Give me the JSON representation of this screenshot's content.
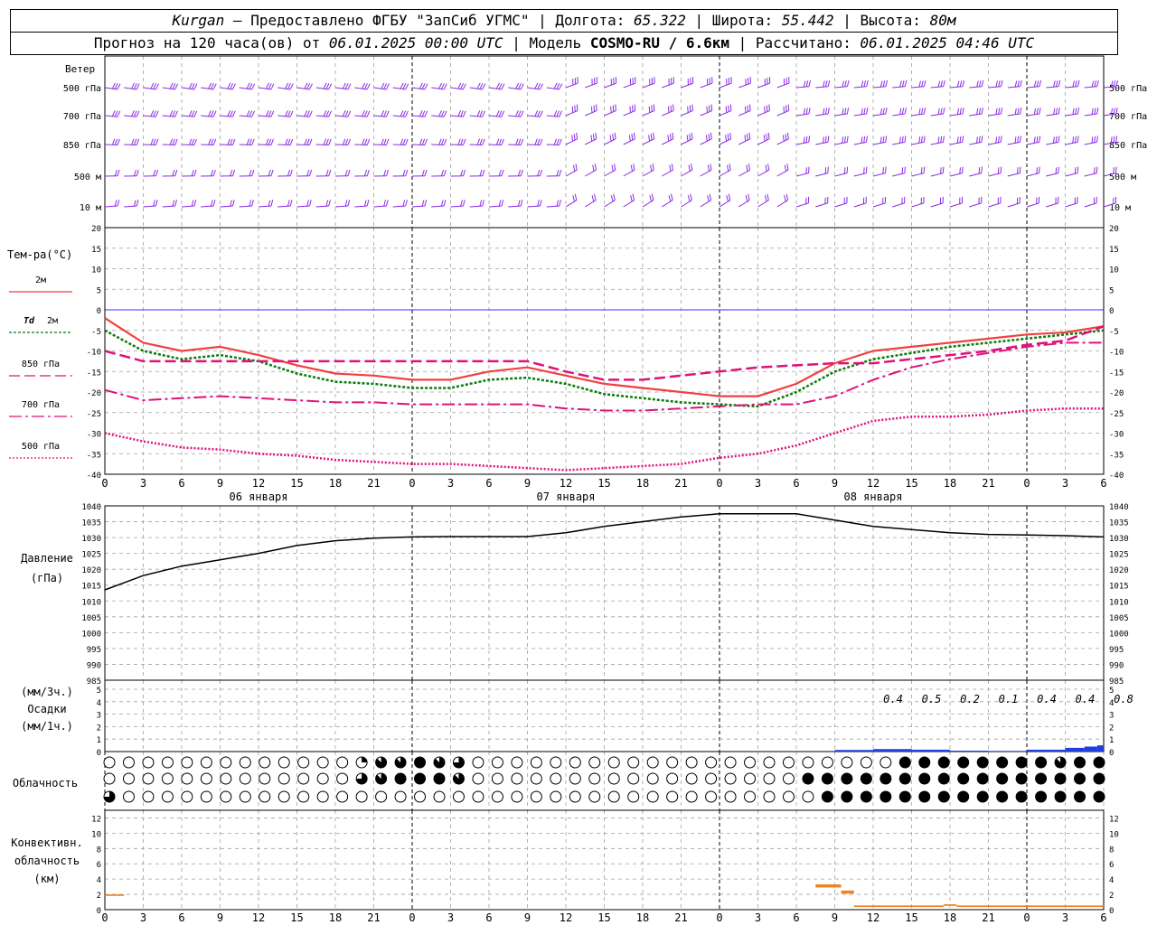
{
  "header": {
    "line1": {
      "station": "Kurgan",
      "sep": " – ",
      "provider": "Предоставлено ФГБУ \"ЗапСиб УГМС\"",
      "lon_label": " | Долгота: ",
      "lon": "65.322",
      "lat_label": " | Широта: ",
      "lat": "55.442",
      "alt_label": " | Высота: ",
      "alt": "80м"
    },
    "line2": {
      "forecast_label": "Прогноз на 120 часа(ов) от ",
      "forecast_from": "06.01.2025 00:00 UTC",
      "model_label": "  | Модель ",
      "model": "COSMO-RU / 6.6км",
      "computed_label": " | Рассчитано: ",
      "computed": "06.01.2025 04:46 UTC"
    }
  },
  "colors": {
    "wind": "#8a2be2",
    "t2m": "#f04040",
    "td2m": "#0a7a0a",
    "t850": "#e0107a",
    "t700": "#e0107a",
    "t500": "#e0107a",
    "zero_line": "#3030ff",
    "pressure": "#000000",
    "precip": "#2040e0",
    "convective": "#f08020",
    "grid": "#a0a0a0"
  },
  "chart_data": [
    {
      "type": "wind_barbs",
      "title": "Ветер",
      "levels": [
        "500 гПа",
        "700 гПа",
        "850 гПа",
        "500 м",
        "10 м"
      ]
    },
    {
      "type": "line",
      "ylabel": "Тем-ра(°С)",
      "ylim": [
        -40,
        20
      ],
      "yticks": [
        20,
        15,
        10,
        5,
        0,
        -5,
        -10,
        -15,
        -20,
        -25,
        -30,
        -35,
        -40
      ],
      "x_hours": [
        0,
        3,
        6,
        9,
        12,
        15,
        18,
        21,
        24,
        27,
        30,
        33,
        36,
        39,
        42,
        45,
        48,
        51,
        54,
        57,
        60,
        63,
        66,
        69,
        72,
        75,
        78
      ],
      "x_ticklabels": [
        "0",
        "3",
        "6",
        "9",
        "12",
        "15",
        "18",
        "21",
        "0",
        "3",
        "6",
        "9",
        "12",
        "15",
        "18",
        "21",
        "0",
        "3",
        "6",
        "9",
        "12",
        "15",
        "18",
        "21",
        "0",
        "3",
        "6"
      ],
      "date_labels": [
        {
          "hour": 12,
          "text": "06 января"
        },
        {
          "hour": 36,
          "text": "07 января"
        },
        {
          "hour": 60,
          "text": "08 января"
        }
      ],
      "series": [
        {
          "name": "2м",
          "style": "t2m",
          "values": [
            -2,
            -8,
            -10,
            -9,
            -11,
            -13.5,
            -15.5,
            -16,
            -17,
            -17,
            -15,
            -14,
            -16,
            -18,
            -19,
            -20,
            -21,
            -21,
            -18,
            -13,
            -10,
            -9,
            -8,
            -7,
            -6,
            -5.5,
            -4
          ]
        },
        {
          "name": "Td 2м",
          "style": "td2m",
          "values": [
            -5,
            -10,
            -12,
            -11,
            -12.5,
            -15.5,
            -17.5,
            -18,
            -19,
            -19,
            -17,
            -16.5,
            -18,
            -20.5,
            -21.5,
            -22.5,
            -23,
            -23.5,
            -20,
            -15,
            -12,
            -10.5,
            -9,
            -8,
            -7,
            -6,
            -5
          ]
        },
        {
          "name": "850 гПа",
          "style": "t850",
          "values": [
            -10,
            -12.5,
            -12.5,
            -12.5,
            -12.5,
            -12.5,
            -12.5,
            -12.5,
            -12.5,
            -12.5,
            -12.5,
            -12.5,
            -15,
            -17,
            -17,
            -16,
            -15,
            -14,
            -13.5,
            -13,
            -13,
            -12,
            -11,
            -10,
            -8.5,
            -7.5,
            -4
          ]
        },
        {
          "name": "700 гПа",
          "style": "t700",
          "values": [
            -19.5,
            -22,
            -21.5,
            -21,
            -21.5,
            -22,
            -22.5,
            -22.5,
            -23,
            -23,
            -23,
            -23,
            -24,
            -24.5,
            -24.5,
            -24,
            -23.5,
            -23,
            -23,
            -21,
            -17,
            -14,
            -12,
            -10.5,
            -9,
            -8,
            -8
          ]
        },
        {
          "name": "500 гПа",
          "style": "t500",
          "values": [
            -30,
            -32,
            -33.5,
            -34,
            -35,
            -35.5,
            -36.5,
            -37,
            -37.5,
            -37.5,
            -38,
            -38.5,
            -39,
            -38.5,
            -38,
            -37.5,
            -36,
            -35,
            -33,
            -30,
            -27,
            -26,
            -26,
            -25.5,
            -24.5,
            -24,
            -24
          ]
        }
      ],
      "zero_line": 0
    },
    {
      "type": "line",
      "ylabel": "Давление",
      "yunit": "(гПа)",
      "ylim": [
        985,
        1040
      ],
      "yticks": [
        1040,
        1035,
        1030,
        1025,
        1020,
        1015,
        1010,
        1005,
        1000,
        995,
        990,
        985
      ],
      "series": [
        {
          "name": "Давление",
          "values": [
            1013.5,
            1018,
            1021,
            1023,
            1025,
            1027.5,
            1029,
            1029.8,
            1030.2,
            1030.3,
            1030.3,
            1030.3,
            1031.5,
            1033.5,
            1035,
            1036.5,
            1037.5,
            1037.5,
            1037.5,
            1035.5,
            1033.5,
            1032.5,
            1031.5,
            1031,
            1030.8,
            1030.6,
            1030.2
          ]
        }
      ]
    },
    {
      "type": "bar",
      "ylabel": "Осадки",
      "yunit_top": "(мм/3ч.)",
      "yunit_bottom": "(мм/1ч.)",
      "ylim": [
        0,
        5
      ],
      "yticks": [
        5,
        4,
        3,
        2,
        1,
        0
      ],
      "labels_3h": [
        {
          "hour": 60,
          "text": "0.4"
        },
        {
          "hour": 63,
          "text": "0.5"
        },
        {
          "hour": 66,
          "text": "0.2"
        },
        {
          "hour": 69,
          "text": "0.1"
        },
        {
          "hour": 72,
          "text": "0.4"
        },
        {
          "hour": 75,
          "text": "0.4"
        },
        {
          "hour": 78,
          "text": "0.8"
        }
      ],
      "bars_1h": [
        {
          "from": 57,
          "to": 60,
          "value": 0.13
        },
        {
          "from": 60,
          "to": 63,
          "value": 0.2
        },
        {
          "from": 63,
          "to": 66,
          "value": 0.15
        },
        {
          "from": 66,
          "to": 69,
          "value": 0.07
        },
        {
          "from": 69,
          "to": 72,
          "value": 0.05
        },
        {
          "from": 72,
          "to": 75,
          "value": 0.15
        },
        {
          "from": 75,
          "to": 76.5,
          "value": 0.3
        },
        {
          "from": 76.5,
          "to": 77.5,
          "value": 0.4
        },
        {
          "from": 77.5,
          "to": 78,
          "value": 0.5
        }
      ]
    },
    {
      "type": "cloud_symbols",
      "ylabel": "Облачность",
      "rows": [
        {
          "name": "upper",
          "values": [
            0,
            0,
            0,
            0,
            0,
            0,
            0,
            0,
            0,
            0,
            0,
            0,
            0,
            0,
            0,
            0,
            0,
            0,
            0,
            0,
            0,
            0,
            0,
            0,
            0,
            0,
            0,
            0,
            0,
            0,
            0,
            0,
            0,
            0,
            0,
            0,
            0,
            0,
            0,
            0,
            1,
            2,
            3,
            5,
            7,
            6,
            8,
            7,
            8,
            7,
            8,
            7,
            8,
            7,
            7,
            6,
            5,
            6,
            4,
            2,
            0,
            0,
            0,
            0,
            0,
            0,
            0,
            0,
            0,
            0,
            0,
            0,
            0,
            0,
            0,
            0,
            0,
            0,
            0,
            0,
            0,
            0,
            0,
            0,
            0,
            0,
            0,
            0,
            0,
            0,
            0,
            0,
            0,
            0,
            0,
            0,
            0,
            0,
            0,
            0,
            0,
            0,
            0,
            0,
            0,
            0,
            0,
            0,
            0,
            0,
            0,
            0,
            0,
            0,
            0,
            0,
            0,
            0,
            0,
            0,
            0,
            0,
            0,
            0,
            0,
            0,
            0,
            0,
            8,
            8,
            8,
            8,
            8,
            8,
            8,
            8,
            8,
            8,
            8,
            8,
            8,
            7,
            8,
            8,
            8,
            8,
            7,
            8,
            8,
            8,
            8,
            7,
            8,
            8,
            8,
            7,
            8,
            8,
            8,
            8,
            8,
            8,
            8,
            8,
            4
          ]
        },
        {
          "name": "middle",
          "values": [
            0,
            0,
            0,
            0,
            0,
            0,
            0,
            0,
            0,
            0,
            0,
            0,
            0,
            0,
            0,
            0,
            0,
            0,
            0,
            0,
            0,
            0,
            0,
            0,
            0,
            0,
            0,
            0,
            0,
            0,
            0,
            0,
            0,
            0,
            0,
            0,
            0,
            0,
            0,
            0,
            2,
            4,
            3,
            6,
            7,
            8,
            7,
            8,
            8,
            8,
            8,
            8,
            8,
            8,
            8,
            8,
            8,
            8,
            8,
            7,
            0,
            0,
            0,
            0,
            0,
            0,
            0,
            0,
            0,
            0,
            0,
            0,
            0,
            0,
            0,
            0,
            0,
            0,
            0,
            0,
            0,
            0,
            0,
            0,
            0,
            0,
            0,
            0,
            0,
            0,
            0,
            0,
            0,
            0,
            0,
            0,
            0,
            0,
            0,
            0,
            0,
            0,
            0,
            0,
            0,
            0,
            0,
            0,
            0,
            0,
            0,
            0,
            0,
            0,
            0,
            0,
            0,
            4,
            8,
            8,
            8,
            8,
            8,
            8,
            8,
            8,
            8,
            8,
            8,
            8,
            8,
            8,
            8,
            8,
            8,
            8,
            8,
            8,
            8,
            8,
            8,
            8,
            8,
            8,
            8,
            8,
            8,
            8,
            8,
            8,
            8,
            8,
            8,
            8,
            8,
            8,
            8,
            8,
            8,
            8,
            8,
            8,
            8,
            8,
            8,
            8,
            8,
            8,
            8,
            8,
            8,
            8
          ]
        },
        {
          "name": "lower",
          "values": [
            6,
            0,
            0,
            0,
            0,
            0,
            0,
            0,
            0,
            0,
            0,
            0,
            0,
            0,
            0,
            0,
            0,
            0,
            0,
            0,
            0,
            0,
            0,
            0,
            0,
            0,
            0,
            0,
            0,
            0,
            0,
            0,
            0,
            0,
            0,
            0,
            0,
            0,
            0,
            0,
            0,
            0,
            0,
            0,
            0,
            0,
            0,
            0,
            0,
            0,
            0,
            0,
            0,
            0,
            0,
            0,
            0,
            0,
            0,
            0,
            0,
            0,
            0,
            0,
            0,
            0,
            0,
            0,
            0,
            0,
            0,
            0,
            0,
            0,
            0,
            0,
            0,
            0,
            0,
            0,
            0,
            0,
            0,
            0,
            0,
            0,
            0,
            0,
            0,
            0,
            0,
            0,
            0,
            0,
            0,
            0,
            0,
            0,
            0,
            0,
            0,
            0,
            0,
            0,
            0,
            0,
            0,
            0,
            0,
            0,
            0,
            0,
            0,
            0,
            0,
            0,
            0,
            0,
            0,
            0,
            0,
            0,
            0,
            0,
            0,
            0,
            0,
            0,
            8,
            8,
            8,
            8,
            8,
            8,
            8,
            8,
            8,
            8,
            8,
            8,
            8,
            8,
            8,
            8,
            8,
            8,
            8,
            8,
            8,
            8,
            8,
            8,
            8,
            8,
            8,
            8,
            8,
            8,
            8,
            8,
            8,
            8,
            8,
            8,
            8,
            8,
            8,
            8,
            8,
            8,
            8,
            8,
            8,
            8,
            8,
            8,
            8,
            8,
            8,
            8,
            8,
            8
          ]
        }
      ]
    },
    {
      "type": "bar",
      "ylabel_lines": [
        "Конвективн.",
        "облачность",
        "(км)"
      ],
      "ylim": [
        0,
        13
      ],
      "yticks": [
        12,
        10,
        8,
        6,
        4,
        2,
        0
      ],
      "bars": [
        {
          "from": 0,
          "to": 1.5,
          "bottom": 1.8,
          "top": 2.0
        },
        {
          "from": 55.5,
          "to": 57.5,
          "bottom": 2.9,
          "top": 3.3
        },
        {
          "from": 57.5,
          "to": 58.5,
          "bottom": 2.1,
          "top": 2.5
        },
        {
          "from": 58.5,
          "to": 65.5,
          "bottom": 0.35,
          "top": 0.55
        },
        {
          "from": 65.5,
          "to": 66.5,
          "bottom": 0.5,
          "top": 0.7
        },
        {
          "from": 66.5,
          "to": 78,
          "bottom": 0.35,
          "top": 0.55
        }
      ]
    }
  ]
}
